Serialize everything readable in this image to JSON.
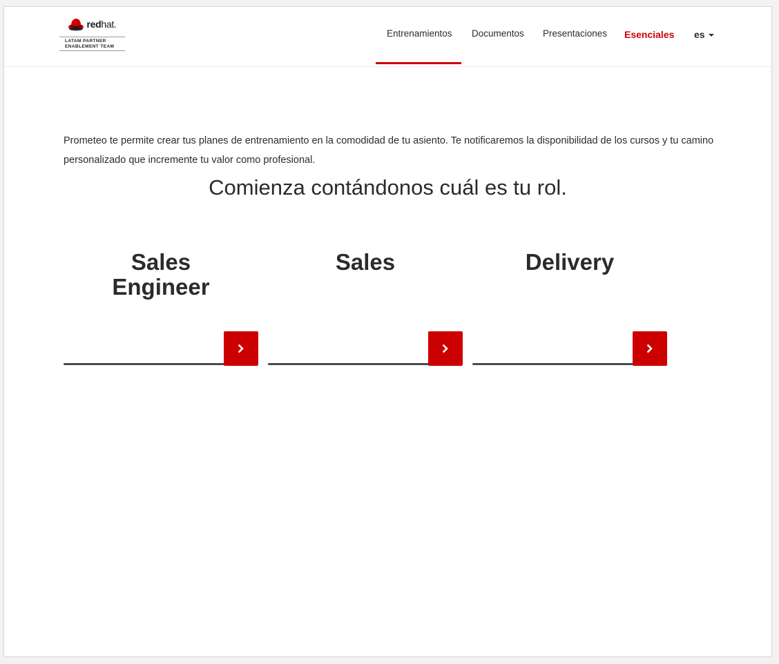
{
  "brand": {
    "wordmark_bold": "red",
    "wordmark_light": "hat.",
    "subtitle_line1": "LATAM PARTNER",
    "subtitle_line2": "ENABLEMENT TEAM"
  },
  "nav": {
    "items": [
      {
        "label": "Entrenamientos",
        "active": true
      },
      {
        "label": "Documentos"
      },
      {
        "label": "Presentaciones"
      },
      {
        "label": "Esenciales",
        "highlight": true
      }
    ],
    "language": "es"
  },
  "main": {
    "intro": "Prometeo te permite crear tus planes de entrenamiento en la comodidad de tu asiento. Te notificaremos la disponibilidad de los cursos y tu camino personalizado que incremente tu valor como profesional.",
    "headline": "Comienza contándonos cuál es tu rol.",
    "roles": [
      {
        "title": "Sales Engineer"
      },
      {
        "title": "Sales"
      },
      {
        "title": "Delivery"
      }
    ]
  },
  "colors": {
    "accent": "#cc0000",
    "text": "#2b2b2b"
  },
  "icons": {
    "role_button": "chevron-right-icon",
    "logo": "red-hat-logo-icon"
  }
}
